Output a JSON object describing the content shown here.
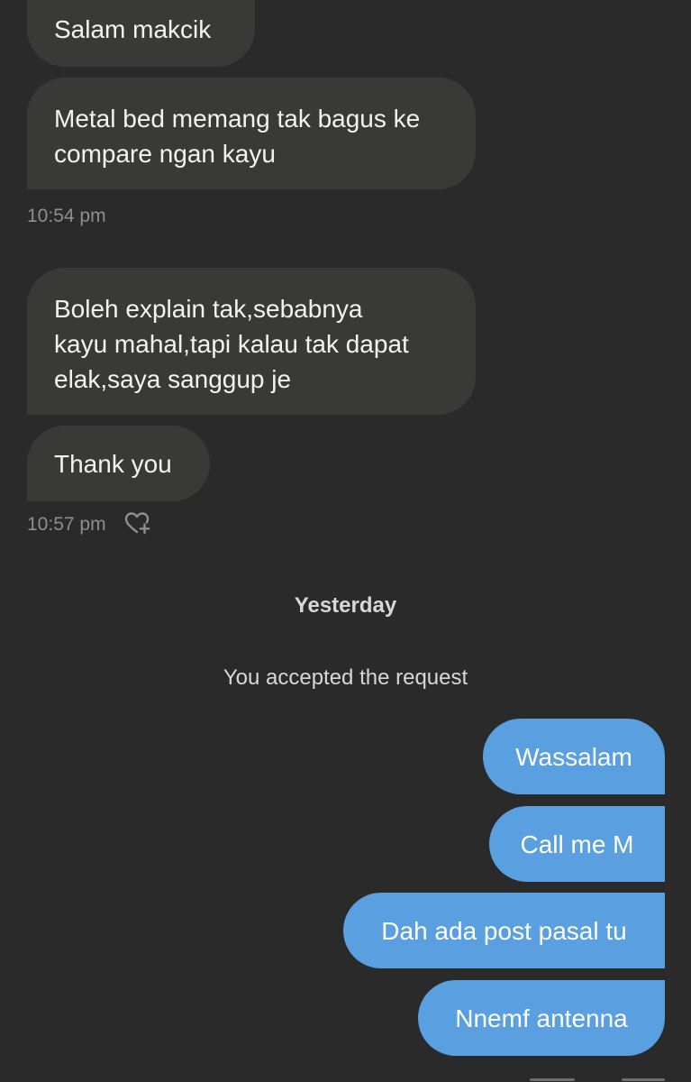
{
  "messages": {
    "m1": "Salam makcik",
    "m2_line1": "Metal bed memang tak bagus ke",
    "m2_line2": "compare ngan kayu",
    "t1": "10:54 pm",
    "m3_line1": "Boleh explain tak,sebabnya",
    "m3_line2": "kayu mahal,tapi kalau tak dapat",
    "m3_line3": "elak,saya sanggup je",
    "m4": "Thank you",
    "t2": "10:57 pm",
    "day_separator": "Yesterday",
    "system_note": "You accepted the request",
    "o1": "Wassalam",
    "o2": "Call me M",
    "o3": "Dah ada post pasal tu",
    "o4": "Nnemf antenna"
  },
  "icons": {
    "reaction": "heart-plus-icon"
  },
  "colors": {
    "background": "#2a2a2a",
    "incoming_bubble": "#393935",
    "outgoing_bubble": "#5a9fe0",
    "timestamp": "#8e8e8e"
  }
}
